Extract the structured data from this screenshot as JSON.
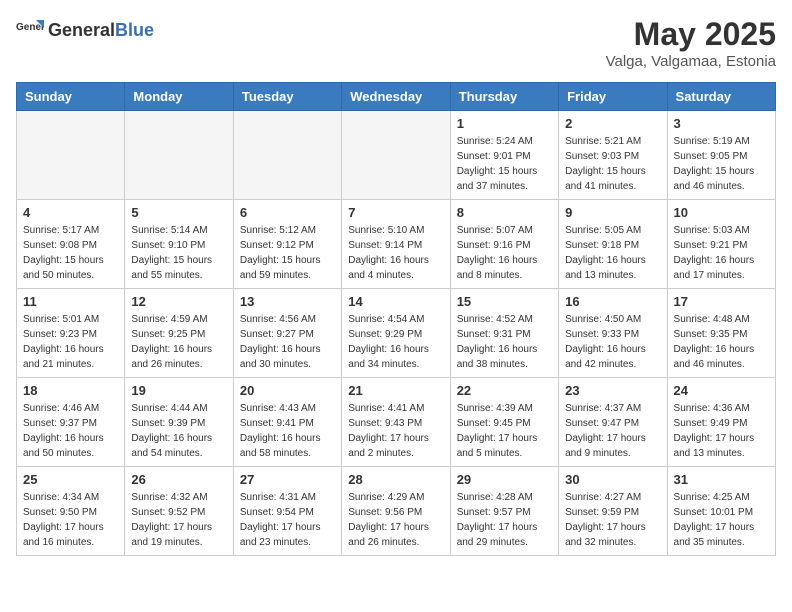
{
  "header": {
    "logo_general": "General",
    "logo_blue": "Blue",
    "month_year": "May 2025",
    "location": "Valga, Valgamaa, Estonia"
  },
  "weekdays": [
    "Sunday",
    "Monday",
    "Tuesday",
    "Wednesday",
    "Thursday",
    "Friday",
    "Saturday"
  ],
  "weeks": [
    [
      {
        "day": "",
        "info": ""
      },
      {
        "day": "",
        "info": ""
      },
      {
        "day": "",
        "info": ""
      },
      {
        "day": "",
        "info": ""
      },
      {
        "day": "1",
        "info": "Sunrise: 5:24 AM\nSunset: 9:01 PM\nDaylight: 15 hours\nand 37 minutes."
      },
      {
        "day": "2",
        "info": "Sunrise: 5:21 AM\nSunset: 9:03 PM\nDaylight: 15 hours\nand 41 minutes."
      },
      {
        "day": "3",
        "info": "Sunrise: 5:19 AM\nSunset: 9:05 PM\nDaylight: 15 hours\nand 46 minutes."
      }
    ],
    [
      {
        "day": "4",
        "info": "Sunrise: 5:17 AM\nSunset: 9:08 PM\nDaylight: 15 hours\nand 50 minutes."
      },
      {
        "day": "5",
        "info": "Sunrise: 5:14 AM\nSunset: 9:10 PM\nDaylight: 15 hours\nand 55 minutes."
      },
      {
        "day": "6",
        "info": "Sunrise: 5:12 AM\nSunset: 9:12 PM\nDaylight: 15 hours\nand 59 minutes."
      },
      {
        "day": "7",
        "info": "Sunrise: 5:10 AM\nSunset: 9:14 PM\nDaylight: 16 hours\nand 4 minutes."
      },
      {
        "day": "8",
        "info": "Sunrise: 5:07 AM\nSunset: 9:16 PM\nDaylight: 16 hours\nand 8 minutes."
      },
      {
        "day": "9",
        "info": "Sunrise: 5:05 AM\nSunset: 9:18 PM\nDaylight: 16 hours\nand 13 minutes."
      },
      {
        "day": "10",
        "info": "Sunrise: 5:03 AM\nSunset: 9:21 PM\nDaylight: 16 hours\nand 17 minutes."
      }
    ],
    [
      {
        "day": "11",
        "info": "Sunrise: 5:01 AM\nSunset: 9:23 PM\nDaylight: 16 hours\nand 21 minutes."
      },
      {
        "day": "12",
        "info": "Sunrise: 4:59 AM\nSunset: 9:25 PM\nDaylight: 16 hours\nand 26 minutes."
      },
      {
        "day": "13",
        "info": "Sunrise: 4:56 AM\nSunset: 9:27 PM\nDaylight: 16 hours\nand 30 minutes."
      },
      {
        "day": "14",
        "info": "Sunrise: 4:54 AM\nSunset: 9:29 PM\nDaylight: 16 hours\nand 34 minutes."
      },
      {
        "day": "15",
        "info": "Sunrise: 4:52 AM\nSunset: 9:31 PM\nDaylight: 16 hours\nand 38 minutes."
      },
      {
        "day": "16",
        "info": "Sunrise: 4:50 AM\nSunset: 9:33 PM\nDaylight: 16 hours\nand 42 minutes."
      },
      {
        "day": "17",
        "info": "Sunrise: 4:48 AM\nSunset: 9:35 PM\nDaylight: 16 hours\nand 46 minutes."
      }
    ],
    [
      {
        "day": "18",
        "info": "Sunrise: 4:46 AM\nSunset: 9:37 PM\nDaylight: 16 hours\nand 50 minutes."
      },
      {
        "day": "19",
        "info": "Sunrise: 4:44 AM\nSunset: 9:39 PM\nDaylight: 16 hours\nand 54 minutes."
      },
      {
        "day": "20",
        "info": "Sunrise: 4:43 AM\nSunset: 9:41 PM\nDaylight: 16 hours\nand 58 minutes."
      },
      {
        "day": "21",
        "info": "Sunrise: 4:41 AM\nSunset: 9:43 PM\nDaylight: 17 hours\nand 2 minutes."
      },
      {
        "day": "22",
        "info": "Sunrise: 4:39 AM\nSunset: 9:45 PM\nDaylight: 17 hours\nand 5 minutes."
      },
      {
        "day": "23",
        "info": "Sunrise: 4:37 AM\nSunset: 9:47 PM\nDaylight: 17 hours\nand 9 minutes."
      },
      {
        "day": "24",
        "info": "Sunrise: 4:36 AM\nSunset: 9:49 PM\nDaylight: 17 hours\nand 13 minutes."
      }
    ],
    [
      {
        "day": "25",
        "info": "Sunrise: 4:34 AM\nSunset: 9:50 PM\nDaylight: 17 hours\nand 16 minutes."
      },
      {
        "day": "26",
        "info": "Sunrise: 4:32 AM\nSunset: 9:52 PM\nDaylight: 17 hours\nand 19 minutes."
      },
      {
        "day": "27",
        "info": "Sunrise: 4:31 AM\nSunset: 9:54 PM\nDaylight: 17 hours\nand 23 minutes."
      },
      {
        "day": "28",
        "info": "Sunrise: 4:29 AM\nSunset: 9:56 PM\nDaylight: 17 hours\nand 26 minutes."
      },
      {
        "day": "29",
        "info": "Sunrise: 4:28 AM\nSunset: 9:57 PM\nDaylight: 17 hours\nand 29 minutes."
      },
      {
        "day": "30",
        "info": "Sunrise: 4:27 AM\nSunset: 9:59 PM\nDaylight: 17 hours\nand 32 minutes."
      },
      {
        "day": "31",
        "info": "Sunrise: 4:25 AM\nSunset: 10:01 PM\nDaylight: 17 hours\nand 35 minutes."
      }
    ]
  ]
}
